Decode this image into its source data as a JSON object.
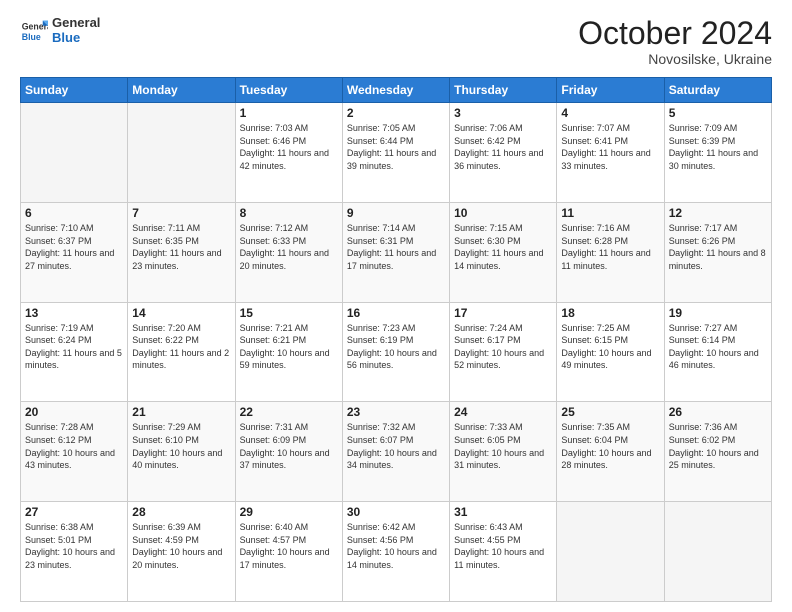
{
  "header": {
    "logo_general": "General",
    "logo_blue": "Blue",
    "month": "October 2024",
    "location": "Novosilske, Ukraine"
  },
  "days_of_week": [
    "Sunday",
    "Monday",
    "Tuesday",
    "Wednesday",
    "Thursday",
    "Friday",
    "Saturday"
  ],
  "weeks": [
    [
      {
        "day": "",
        "info": ""
      },
      {
        "day": "",
        "info": ""
      },
      {
        "day": "1",
        "info": "Sunrise: 7:03 AM\nSunset: 6:46 PM\nDaylight: 11 hours and 42 minutes."
      },
      {
        "day": "2",
        "info": "Sunrise: 7:05 AM\nSunset: 6:44 PM\nDaylight: 11 hours and 39 minutes."
      },
      {
        "day": "3",
        "info": "Sunrise: 7:06 AM\nSunset: 6:42 PM\nDaylight: 11 hours and 36 minutes."
      },
      {
        "day": "4",
        "info": "Sunrise: 7:07 AM\nSunset: 6:41 PM\nDaylight: 11 hours and 33 minutes."
      },
      {
        "day": "5",
        "info": "Sunrise: 7:09 AM\nSunset: 6:39 PM\nDaylight: 11 hours and 30 minutes."
      }
    ],
    [
      {
        "day": "6",
        "info": "Sunrise: 7:10 AM\nSunset: 6:37 PM\nDaylight: 11 hours and 27 minutes."
      },
      {
        "day": "7",
        "info": "Sunrise: 7:11 AM\nSunset: 6:35 PM\nDaylight: 11 hours and 23 minutes."
      },
      {
        "day": "8",
        "info": "Sunrise: 7:12 AM\nSunset: 6:33 PM\nDaylight: 11 hours and 20 minutes."
      },
      {
        "day": "9",
        "info": "Sunrise: 7:14 AM\nSunset: 6:31 PM\nDaylight: 11 hours and 17 minutes."
      },
      {
        "day": "10",
        "info": "Sunrise: 7:15 AM\nSunset: 6:30 PM\nDaylight: 11 hours and 14 minutes."
      },
      {
        "day": "11",
        "info": "Sunrise: 7:16 AM\nSunset: 6:28 PM\nDaylight: 11 hours and 11 minutes."
      },
      {
        "day": "12",
        "info": "Sunrise: 7:17 AM\nSunset: 6:26 PM\nDaylight: 11 hours and 8 minutes."
      }
    ],
    [
      {
        "day": "13",
        "info": "Sunrise: 7:19 AM\nSunset: 6:24 PM\nDaylight: 11 hours and 5 minutes."
      },
      {
        "day": "14",
        "info": "Sunrise: 7:20 AM\nSunset: 6:22 PM\nDaylight: 11 hours and 2 minutes."
      },
      {
        "day": "15",
        "info": "Sunrise: 7:21 AM\nSunset: 6:21 PM\nDaylight: 10 hours and 59 minutes."
      },
      {
        "day": "16",
        "info": "Sunrise: 7:23 AM\nSunset: 6:19 PM\nDaylight: 10 hours and 56 minutes."
      },
      {
        "day": "17",
        "info": "Sunrise: 7:24 AM\nSunset: 6:17 PM\nDaylight: 10 hours and 52 minutes."
      },
      {
        "day": "18",
        "info": "Sunrise: 7:25 AM\nSunset: 6:15 PM\nDaylight: 10 hours and 49 minutes."
      },
      {
        "day": "19",
        "info": "Sunrise: 7:27 AM\nSunset: 6:14 PM\nDaylight: 10 hours and 46 minutes."
      }
    ],
    [
      {
        "day": "20",
        "info": "Sunrise: 7:28 AM\nSunset: 6:12 PM\nDaylight: 10 hours and 43 minutes."
      },
      {
        "day": "21",
        "info": "Sunrise: 7:29 AM\nSunset: 6:10 PM\nDaylight: 10 hours and 40 minutes."
      },
      {
        "day": "22",
        "info": "Sunrise: 7:31 AM\nSunset: 6:09 PM\nDaylight: 10 hours and 37 minutes."
      },
      {
        "day": "23",
        "info": "Sunrise: 7:32 AM\nSunset: 6:07 PM\nDaylight: 10 hours and 34 minutes."
      },
      {
        "day": "24",
        "info": "Sunrise: 7:33 AM\nSunset: 6:05 PM\nDaylight: 10 hours and 31 minutes."
      },
      {
        "day": "25",
        "info": "Sunrise: 7:35 AM\nSunset: 6:04 PM\nDaylight: 10 hours and 28 minutes."
      },
      {
        "day": "26",
        "info": "Sunrise: 7:36 AM\nSunset: 6:02 PM\nDaylight: 10 hours and 25 minutes."
      }
    ],
    [
      {
        "day": "27",
        "info": "Sunrise: 6:38 AM\nSunset: 5:01 PM\nDaylight: 10 hours and 23 minutes."
      },
      {
        "day": "28",
        "info": "Sunrise: 6:39 AM\nSunset: 4:59 PM\nDaylight: 10 hours and 20 minutes."
      },
      {
        "day": "29",
        "info": "Sunrise: 6:40 AM\nSunset: 4:57 PM\nDaylight: 10 hours and 17 minutes."
      },
      {
        "day": "30",
        "info": "Sunrise: 6:42 AM\nSunset: 4:56 PM\nDaylight: 10 hours and 14 minutes."
      },
      {
        "day": "31",
        "info": "Sunrise: 6:43 AM\nSunset: 4:55 PM\nDaylight: 10 hours and 11 minutes."
      },
      {
        "day": "",
        "info": ""
      },
      {
        "day": "",
        "info": ""
      }
    ]
  ]
}
